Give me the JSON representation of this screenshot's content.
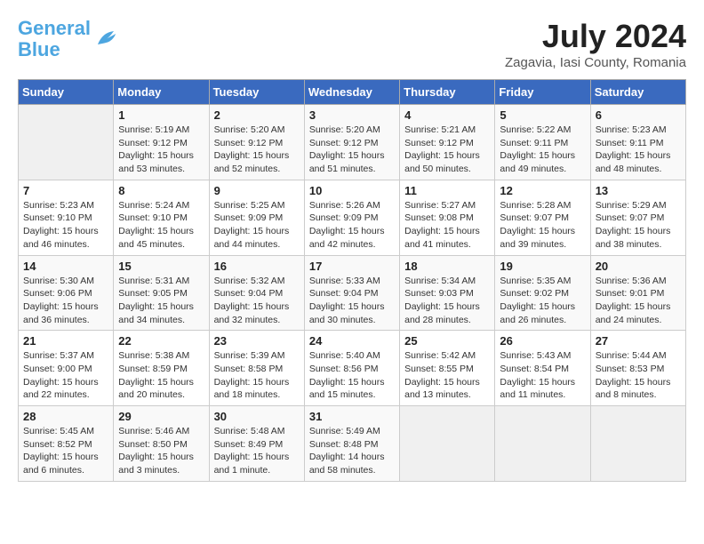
{
  "header": {
    "logo_line1": "General",
    "logo_line2": "Blue",
    "month_year": "July 2024",
    "location": "Zagavia, Iasi County, Romania"
  },
  "weekdays": [
    "Sunday",
    "Monday",
    "Tuesday",
    "Wednesday",
    "Thursday",
    "Friday",
    "Saturday"
  ],
  "weeks": [
    [
      {
        "num": "",
        "info": ""
      },
      {
        "num": "1",
        "info": "Sunrise: 5:19 AM\nSunset: 9:12 PM\nDaylight: 15 hours\nand 53 minutes."
      },
      {
        "num": "2",
        "info": "Sunrise: 5:20 AM\nSunset: 9:12 PM\nDaylight: 15 hours\nand 52 minutes."
      },
      {
        "num": "3",
        "info": "Sunrise: 5:20 AM\nSunset: 9:12 PM\nDaylight: 15 hours\nand 51 minutes."
      },
      {
        "num": "4",
        "info": "Sunrise: 5:21 AM\nSunset: 9:12 PM\nDaylight: 15 hours\nand 50 minutes."
      },
      {
        "num": "5",
        "info": "Sunrise: 5:22 AM\nSunset: 9:11 PM\nDaylight: 15 hours\nand 49 minutes."
      },
      {
        "num": "6",
        "info": "Sunrise: 5:23 AM\nSunset: 9:11 PM\nDaylight: 15 hours\nand 48 minutes."
      }
    ],
    [
      {
        "num": "7",
        "info": "Sunrise: 5:23 AM\nSunset: 9:10 PM\nDaylight: 15 hours\nand 46 minutes."
      },
      {
        "num": "8",
        "info": "Sunrise: 5:24 AM\nSunset: 9:10 PM\nDaylight: 15 hours\nand 45 minutes."
      },
      {
        "num": "9",
        "info": "Sunrise: 5:25 AM\nSunset: 9:09 PM\nDaylight: 15 hours\nand 44 minutes."
      },
      {
        "num": "10",
        "info": "Sunrise: 5:26 AM\nSunset: 9:09 PM\nDaylight: 15 hours\nand 42 minutes."
      },
      {
        "num": "11",
        "info": "Sunrise: 5:27 AM\nSunset: 9:08 PM\nDaylight: 15 hours\nand 41 minutes."
      },
      {
        "num": "12",
        "info": "Sunrise: 5:28 AM\nSunset: 9:07 PM\nDaylight: 15 hours\nand 39 minutes."
      },
      {
        "num": "13",
        "info": "Sunrise: 5:29 AM\nSunset: 9:07 PM\nDaylight: 15 hours\nand 38 minutes."
      }
    ],
    [
      {
        "num": "14",
        "info": "Sunrise: 5:30 AM\nSunset: 9:06 PM\nDaylight: 15 hours\nand 36 minutes."
      },
      {
        "num": "15",
        "info": "Sunrise: 5:31 AM\nSunset: 9:05 PM\nDaylight: 15 hours\nand 34 minutes."
      },
      {
        "num": "16",
        "info": "Sunrise: 5:32 AM\nSunset: 9:04 PM\nDaylight: 15 hours\nand 32 minutes."
      },
      {
        "num": "17",
        "info": "Sunrise: 5:33 AM\nSunset: 9:04 PM\nDaylight: 15 hours\nand 30 minutes."
      },
      {
        "num": "18",
        "info": "Sunrise: 5:34 AM\nSunset: 9:03 PM\nDaylight: 15 hours\nand 28 minutes."
      },
      {
        "num": "19",
        "info": "Sunrise: 5:35 AM\nSunset: 9:02 PM\nDaylight: 15 hours\nand 26 minutes."
      },
      {
        "num": "20",
        "info": "Sunrise: 5:36 AM\nSunset: 9:01 PM\nDaylight: 15 hours\nand 24 minutes."
      }
    ],
    [
      {
        "num": "21",
        "info": "Sunrise: 5:37 AM\nSunset: 9:00 PM\nDaylight: 15 hours\nand 22 minutes."
      },
      {
        "num": "22",
        "info": "Sunrise: 5:38 AM\nSunset: 8:59 PM\nDaylight: 15 hours\nand 20 minutes."
      },
      {
        "num": "23",
        "info": "Sunrise: 5:39 AM\nSunset: 8:58 PM\nDaylight: 15 hours\nand 18 minutes."
      },
      {
        "num": "24",
        "info": "Sunrise: 5:40 AM\nSunset: 8:56 PM\nDaylight: 15 hours\nand 15 minutes."
      },
      {
        "num": "25",
        "info": "Sunrise: 5:42 AM\nSunset: 8:55 PM\nDaylight: 15 hours\nand 13 minutes."
      },
      {
        "num": "26",
        "info": "Sunrise: 5:43 AM\nSunset: 8:54 PM\nDaylight: 15 hours\nand 11 minutes."
      },
      {
        "num": "27",
        "info": "Sunrise: 5:44 AM\nSunset: 8:53 PM\nDaylight: 15 hours\nand 8 minutes."
      }
    ],
    [
      {
        "num": "28",
        "info": "Sunrise: 5:45 AM\nSunset: 8:52 PM\nDaylight: 15 hours\nand 6 minutes."
      },
      {
        "num": "29",
        "info": "Sunrise: 5:46 AM\nSunset: 8:50 PM\nDaylight: 15 hours\nand 3 minutes."
      },
      {
        "num": "30",
        "info": "Sunrise: 5:48 AM\nSunset: 8:49 PM\nDaylight: 15 hours\nand 1 minute."
      },
      {
        "num": "31",
        "info": "Sunrise: 5:49 AM\nSunset: 8:48 PM\nDaylight: 14 hours\nand 58 minutes."
      },
      {
        "num": "",
        "info": ""
      },
      {
        "num": "",
        "info": ""
      },
      {
        "num": "",
        "info": ""
      }
    ]
  ]
}
